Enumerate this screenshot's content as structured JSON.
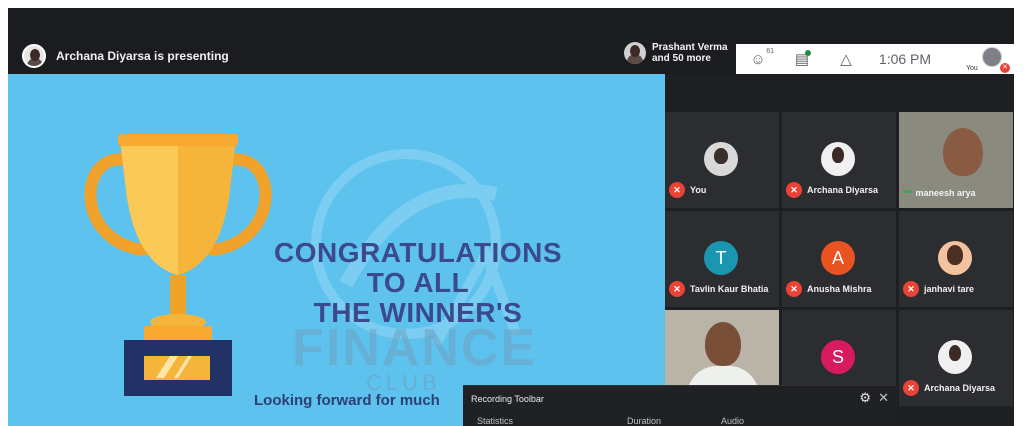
{
  "presenting": {
    "label": "Archana Diyarsa is presenting"
  },
  "people": {
    "line1": "Prashant Verma",
    "line2": "and 50 more"
  },
  "toolbar": {
    "participants_count": "61",
    "time": "1:06 PM",
    "self_label": "You"
  },
  "slide": {
    "heading_lines": [
      "CONGRATULATIONS",
      "TO ALL",
      "THE WINNER'S"
    ],
    "subline": "Looking forward for much",
    "watermark": "FINANCE",
    "watermark_sub": "CLUB"
  },
  "tiles": [
    {
      "name": "You",
      "initial": "",
      "muted": true
    },
    {
      "name": "Archana Diyarsa",
      "initial": "",
      "muted": true
    },
    {
      "name": "maneesh arya",
      "initial": "",
      "muted": false,
      "speaking": true
    },
    {
      "name": "Tavlin Kaur Bhatia",
      "initial": "T",
      "color": "#1a96b0",
      "muted": true
    },
    {
      "name": "Anusha Mishra",
      "initial": "A",
      "color": "#e8531f",
      "muted": true
    },
    {
      "name": "janhavi tare",
      "initial": "",
      "muted": true
    },
    {
      "name": "",
      "initial": "",
      "muted": false
    },
    {
      "name": "",
      "initial": "S",
      "color": "#d81b60",
      "muted": false
    },
    {
      "name": "Archana Diyarsa",
      "initial": "",
      "muted": true
    }
  ],
  "recording": {
    "title": "Recording Toolbar",
    "columns": [
      "Statistics",
      "Duration",
      "Audio"
    ]
  }
}
